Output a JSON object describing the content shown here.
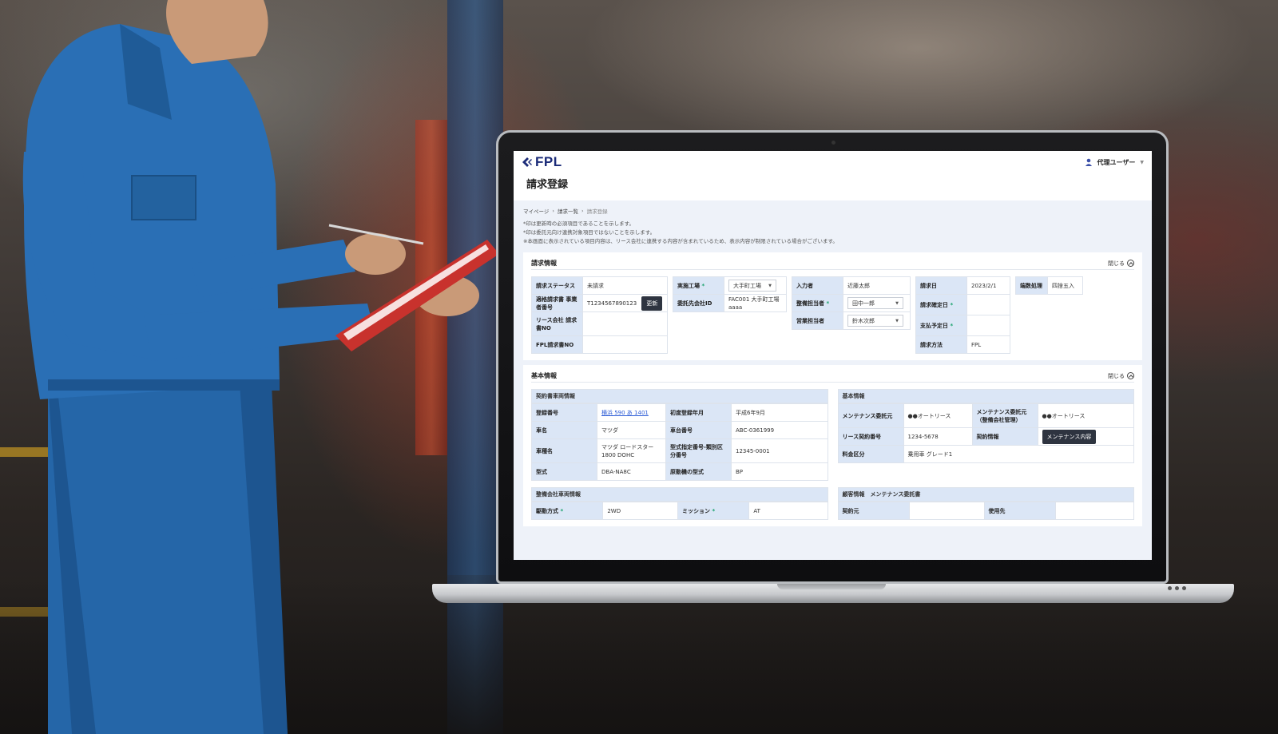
{
  "app": {
    "logo_text": "FPL",
    "user_label": "代理ユーザー",
    "page_title": "請求登録"
  },
  "breadcrumb": [
    "マイページ",
    "請求一覧",
    "請求登録"
  ],
  "notes": [
    "*印は更新時の必須項目であることを示します。",
    "*印は委託元向け連携対象項目ではないことを示します。",
    "※本画面に表示されている項目内容は、リース会社に連携する内容が含まれているため、表示内容が制限されている場合がございます。"
  ],
  "invoice_panel": {
    "title": "請求情報",
    "toggle": "閉じる",
    "status_label": "請求ステータス",
    "status_value": "未請求",
    "qualified_label": "適格請求書 事業者番号",
    "qualified_value": "T1234567890123",
    "update_button": "更新",
    "lease_no_label": "リース会社 請求書NO",
    "lease_no_value": "",
    "fpl_no_label": "FPL請求書NO",
    "fpl_no_value": "",
    "factory_label": "実施工場",
    "factory_value": "大手町工場",
    "client_id_label": "委託先会社ID",
    "client_id_value": "FAC001 大手町工場 aaaa",
    "entered_by_label": "入力者",
    "entered_by_value": "近藤太郎",
    "maint_staff_label": "整備担当者",
    "maint_staff_value": "田中一郎",
    "sales_staff_label": "営業担当者",
    "sales_staff_value": "鈴木次郎",
    "invoice_date_label": "請求日",
    "invoice_date_value": "2023/2/1",
    "confirm_date_label": "請求確定日",
    "confirm_date_value": "",
    "pay_date_label": "支払予定日",
    "pay_date_value": "",
    "method_label": "請求方法",
    "method_value": "FPL",
    "rounding_label": "端数処理",
    "rounding_value": "四捨五入"
  },
  "basic_panel": {
    "title": "基本情報",
    "toggle": "閉じる",
    "contract_vehicle": {
      "head": "契約書車両情報",
      "reg_no_label": "登録番号",
      "reg_no_value": "横浜 590 あ 1401",
      "first_reg_label": "初度登録年月",
      "first_reg_value": "平成6年9月",
      "make_label": "車名",
      "make_value": "マツダ",
      "chassis_label": "車台番号",
      "chassis_value": "ABC-0361999",
      "model_name_label": "車種名",
      "model_name_value": "マツダ ロードスター 1800 DOHC",
      "type_no_label": "型式指定番号-類別区分番号",
      "type_no_value": "12345-0001",
      "model_label": "型式",
      "model_value": "DBA-NA8C",
      "engine_label": "原動機の型式",
      "engine_value": "BP"
    },
    "basic_info": {
      "head": "基本情報",
      "maint_from_label": "メンテナンス委託元",
      "maint_from_value": "●●オートリース",
      "maint_from2_label": "メンテナンス委託元（整備会社管理）",
      "maint_from2_value": "●●オートリース",
      "lease_contract_label": "リース契約番号",
      "lease_contract_value": "1234-5678",
      "contract_info_label": "契約情報",
      "maint_content_button": "メンテナンス内容",
      "fee_label": "料金区分",
      "fee_value": "乗用車 グレード1"
    },
    "shop_vehicle": {
      "head": "整備会社車両情報",
      "drive_label": "駆動方式",
      "drive_value": "2WD",
      "mission_label": "ミッション",
      "mission_value": "AT"
    },
    "customer": {
      "head": "顧客情報　メンテナンス委託書",
      "contract_from_label": "契約元",
      "contract_from_value": "",
      "user_label": "使用先",
      "user_value": ""
    }
  },
  "colors": {
    "brand": "#1b2b78",
    "label_bg": "#dbe6f6",
    "content_bg": "#eef2f9",
    "required": "#1aa36c",
    "dark_button": "#2e3440"
  }
}
